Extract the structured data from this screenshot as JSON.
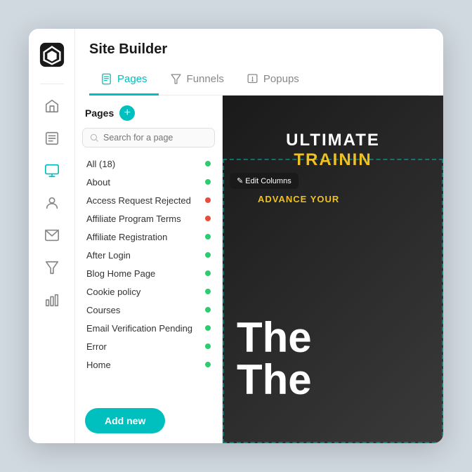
{
  "app": {
    "title": "Site Builder"
  },
  "tabs": [
    {
      "id": "pages",
      "label": "Pages",
      "active": true
    },
    {
      "id": "funnels",
      "label": "Funnels",
      "active": false
    },
    {
      "id": "popups",
      "label": "Popups",
      "active": false
    }
  ],
  "pages_panel": {
    "header_label": "Pages",
    "search_placeholder": "Search for a page",
    "add_new_label": "Add new",
    "pages_list": [
      {
        "name": "All (18)",
        "dot": "green"
      },
      {
        "name": "About",
        "dot": "green"
      },
      {
        "name": "Access Request Rejected",
        "dot": "red"
      },
      {
        "name": "Affiliate Program Terms",
        "dot": "red"
      },
      {
        "name": "Affiliate  Registration",
        "dot": "green"
      },
      {
        "name": "After Login",
        "dot": "green"
      },
      {
        "name": "Blog Home Page",
        "dot": "green"
      },
      {
        "name": "Cookie policy",
        "dot": "green"
      },
      {
        "name": "Courses",
        "dot": "green"
      },
      {
        "name": "Email Verification Pending",
        "dot": "green"
      },
      {
        "name": "Error",
        "dot": "green"
      },
      {
        "name": "Home",
        "dot": "green"
      }
    ]
  },
  "sidebar": {
    "icons": [
      {
        "id": "home",
        "label": "Home"
      },
      {
        "id": "book",
        "label": "Content"
      },
      {
        "id": "monitor",
        "label": "Site Builder",
        "active": true
      },
      {
        "id": "user",
        "label": "Members"
      },
      {
        "id": "mail",
        "label": "Email"
      },
      {
        "id": "filter",
        "label": "Funnels"
      },
      {
        "id": "chart",
        "label": "Analytics"
      }
    ]
  },
  "preview": {
    "ultimate": "ULTIMATE",
    "training": "TRAININ",
    "edit_columns": "✎ Edit Columns",
    "advance_your": "ADVANCE YOUR",
    "the_text": "The",
    "the_text2": "The"
  }
}
